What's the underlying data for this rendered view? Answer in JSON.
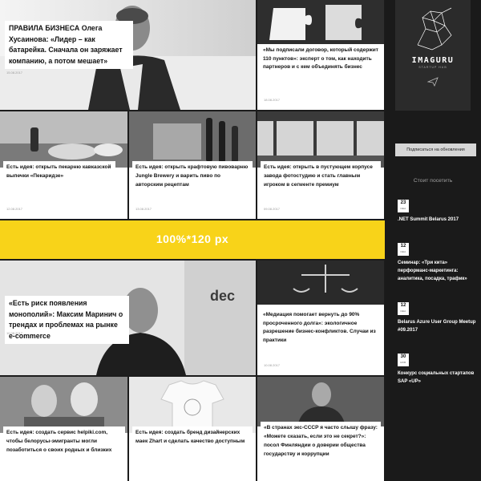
{
  "articles_top": {
    "feature": {
      "title": "ПРАВИЛА БИЗНЕСА Олега Хусаинова: «Лидер – как батарейка. Сначала он заряжает компанию, а потом мешает»",
      "date": "15.08.2017"
    },
    "contract": {
      "title": "«Мы подписали договор, который содержит 110 пунктов»: эксперт о том, как находить партнеров и с кем объединять бизнес",
      "date": "18.08.2017"
    },
    "bakery": {
      "title": "Есть идея: открыть пекарню кавказской выпечки «Пекаридзе»",
      "date": "12.08.2017"
    },
    "brewery": {
      "title": "Есть идея: открыть крафтовую пивоварню Jungle Brewery и варить пиво по авторским рецептам",
      "date": "13.08.2017"
    },
    "photostudio": {
      "title": "Есть идея: открыть в пустующем корпусе завода фотостудию и стать главным игроком в сегменте премиум",
      "date": "09.08.2017"
    }
  },
  "banner": {
    "label": "100%*120 px"
  },
  "articles_bottom": {
    "feature": {
      "title": "«Есть риск появления монополий»: Максим Маринич о трендах и проблемах на рынке e-commerce",
      "date": "10.08.2017"
    },
    "mediation": {
      "title": "«Медиация помогает вернуть до 90% просроченного долга»: экологичное разрешение бизнес-конфликтов. Случаи из практики",
      "date": "10.08.2017"
    },
    "helpiki": {
      "title": "Есть идея: создать сервис helpiki.com, чтобы белорусы-эмигранты могли позаботиться о своих родных и близких"
    },
    "zhart": {
      "title": "Есть идея: создать бренд дизайнерских маек Zhart и сделать качество доступным"
    },
    "finland": {
      "title": "«В странах экс-СССР я часто слышу фразу: «Можете сказать, если это не секрет?»: посол Финляндии о доверии общества государству и коррупции"
    }
  },
  "sidebar": {
    "logo_text": "IMAGURU",
    "logo_subtext": "STARTUP HUB",
    "subscribe_label": "Подписаться на обновления",
    "visit_title": "Стоит посетить",
    "events": [
      {
        "day": "23",
        "month": "СЕН.",
        "title": ".NET Summit Belarus 2017"
      },
      {
        "day": "12",
        "month": "СЕН.",
        "title": "Семинар: «Три кита» перформанс-маркетинга: аналитика, посадка, трафик»"
      },
      {
        "day": "12",
        "month": "СЕН.",
        "title": "Belarus Azure User Group Meetup #09.2017"
      },
      {
        "day": "30",
        "month": "НОЯ.",
        "title": "Конкурс социальных стартапов SAP «UP»"
      }
    ]
  },
  "colors": {
    "banner": "#f8d319",
    "sidebar": "#1a1a1a",
    "logo_box": "#2b2b2b"
  }
}
